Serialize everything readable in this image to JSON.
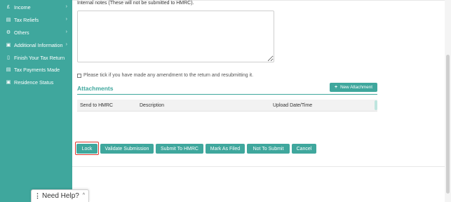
{
  "sidebar": {
    "items": [
      {
        "label": "Income",
        "icon": "pound-icon",
        "glyph": "£",
        "chevron": true
      },
      {
        "label": "Tax Reliefs",
        "icon": "document-icon",
        "glyph": "▤",
        "chevron": true
      },
      {
        "label": "Others",
        "icon": "gears-icon",
        "glyph": "⚙",
        "chevron": true
      },
      {
        "label": "Additional Information",
        "icon": "info-box-icon",
        "glyph": "▣",
        "chevron": true
      },
      {
        "label": "Finish Your Tax Return",
        "icon": "file-icon",
        "glyph": "▯",
        "chevron": false
      },
      {
        "label": "Tax Payments Made",
        "icon": "payment-icon",
        "glyph": "▤",
        "chevron": false
      },
      {
        "label": "Residence Status",
        "icon": "status-icon",
        "glyph": "▣",
        "chevron": false
      }
    ],
    "chevron_glyph": "›"
  },
  "notes": {
    "label": "Internal notes (These will not be submitted to HMRC).",
    "value": ""
  },
  "amendment": {
    "label": "Please tick if you have made any amendment to the return and resubmitting it.",
    "checked": false
  },
  "attachments": {
    "title": "Attachments",
    "new_button_label": "New Attachment",
    "new_button_glyph": "+",
    "columns": [
      "Send to HMRC",
      "Description",
      "Upload Date/Time"
    ],
    "rows": []
  },
  "actions": {
    "lock": "Lock",
    "validate": "Validate Submission",
    "submit": "Submit To HMRC",
    "mark_filed": "Mark As Filed",
    "not_submit": "Not To Submit",
    "cancel": "Cancel"
  },
  "help": {
    "label": "Need Help?",
    "grip": "⋮",
    "caret": "^"
  },
  "colors": {
    "accent": "#3fa79d",
    "highlight": "#d9362c"
  }
}
